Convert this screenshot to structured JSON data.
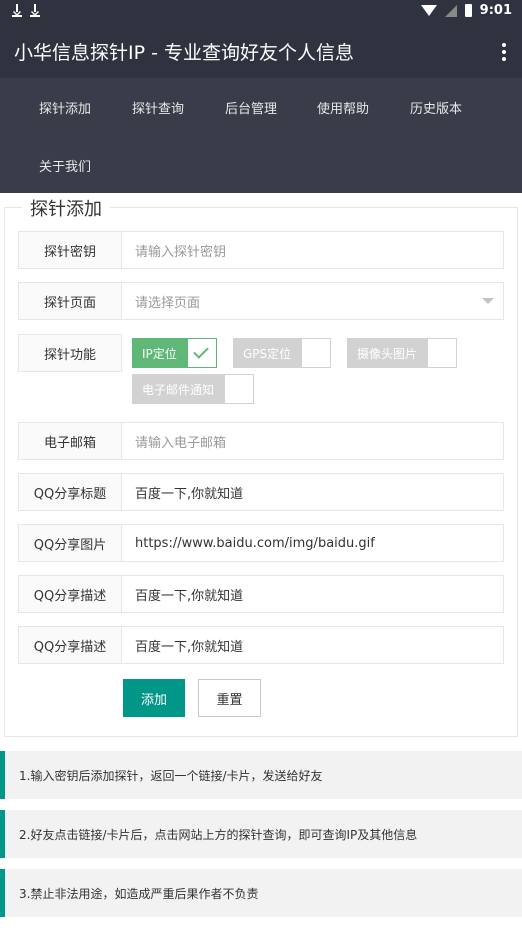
{
  "status_bar": {
    "time": "9:01"
  },
  "app_bar": {
    "title": "小华信息探针IP - 专业查询好友个人信息"
  },
  "nav": {
    "items": [
      "探针添加",
      "探针查询",
      "后台管理",
      "使用帮助",
      "历史版本",
      "关于我们"
    ]
  },
  "form": {
    "legend": "探针添加",
    "key": {
      "label": "探针密钥",
      "placeholder": "请输入探针密钥"
    },
    "page": {
      "label": "探针页面",
      "placeholder": "请选择页面"
    },
    "features": {
      "label": "探针功能",
      "options": [
        {
          "label": "IP定位",
          "checked": true
        },
        {
          "label": "GPS定位",
          "checked": false
        },
        {
          "label": "摄像头图片",
          "checked": false
        },
        {
          "label": "电子邮件通知",
          "checked": false
        }
      ]
    },
    "email": {
      "label": "电子邮箱",
      "placeholder": "请输入电子邮箱"
    },
    "qq_title": {
      "label": "QQ分享标题",
      "value": "百度一下,你就知道"
    },
    "qq_image": {
      "label": "QQ分享图片",
      "value": "https://www.baidu.com/img/baidu.gif"
    },
    "qq_desc1": {
      "label": "QQ分享描述",
      "value": "百度一下,你就知道"
    },
    "qq_desc2": {
      "label": "QQ分享描述",
      "value": "百度一下,你就知道"
    },
    "add_label": "添加",
    "reset_label": "重置"
  },
  "tips": [
    "1.输入密钥后添加探针，返回一个链接/卡片，发送给好友",
    "2.好友点击链接/卡片后，点击网站上方的探针查询，即可查询IP及其他信息",
    "3.禁止非法用途，如造成严重后果作者不负责"
  ],
  "colors": {
    "bar": "#2f3340",
    "nav": "#393d49",
    "accent": "#009688",
    "checked": "#5fb878"
  }
}
